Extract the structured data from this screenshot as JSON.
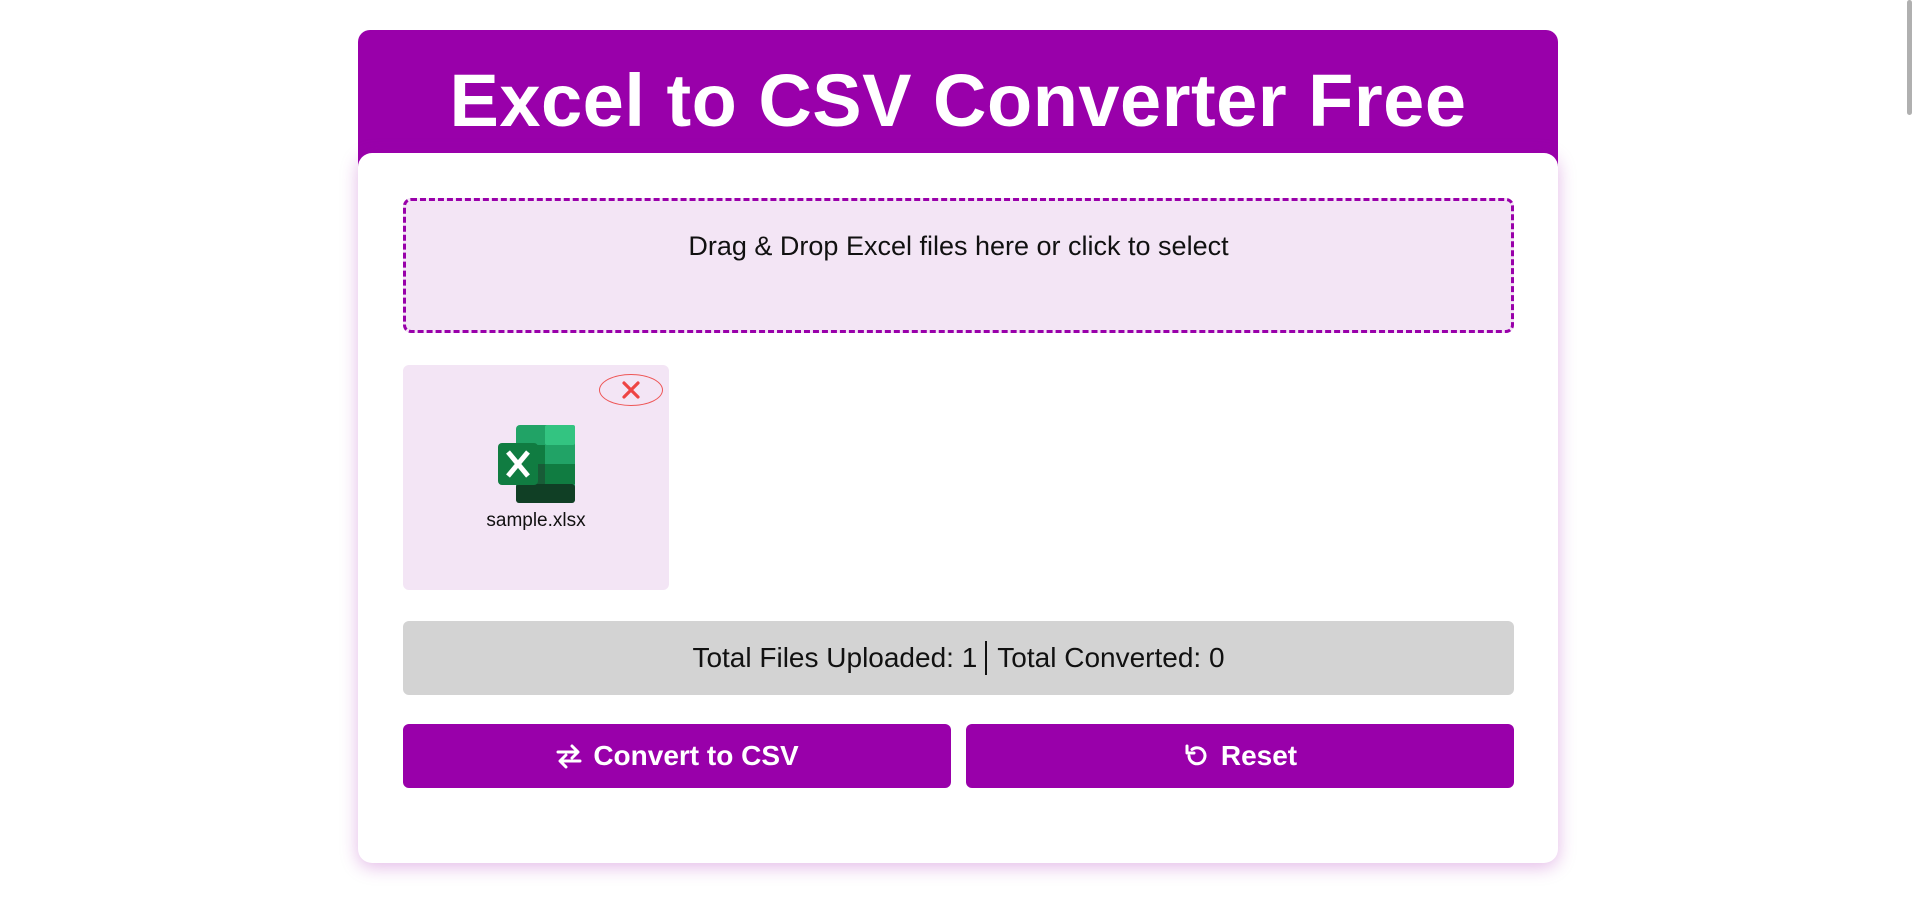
{
  "header": {
    "title": "Excel to CSV Converter Free"
  },
  "dropzone": {
    "label": "Drag & Drop Excel files here or click to select"
  },
  "files": [
    {
      "name": "sample.xlsx",
      "icon": "excel-file-icon"
    }
  ],
  "stats": {
    "uploaded_label": "Total Files Uploaded:",
    "uploaded_count": "1",
    "converted_label": "Total Converted:",
    "converted_count": "0"
  },
  "actions": {
    "convert_label": "Convert to CSV",
    "convert_icon": "swap-arrows-icon",
    "reset_label": "Reset",
    "reset_icon": "rotate-left-icon"
  },
  "colors": {
    "accent": "#9900aa",
    "panel_tint": "#f3e5f5",
    "stats_bg": "#d3d3d3",
    "remove": "#ee5555"
  }
}
